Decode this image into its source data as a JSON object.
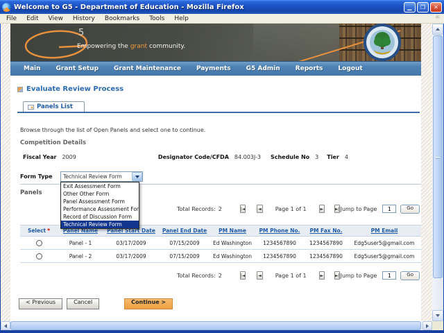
{
  "window": {
    "title": "Welcome to G5 - Department of Education - Mozilla Firefox",
    "controls": {
      "minimize": "▁",
      "restore": "❐",
      "close": "✕"
    },
    "menu_items": [
      "File",
      "Edit",
      "View",
      "History",
      "Bookmarks",
      "Tools",
      "Help"
    ],
    "throbber_glyph": "✳"
  },
  "header": {
    "logo_number": "5",
    "tagline_prefix": "Empowering the",
    "tagline_accent": "grant",
    "tagline_suffix": "community."
  },
  "nav": {
    "items": [
      "Main",
      "Grant Setup",
      "Grant Maintenance",
      "Payments",
      "G5 Admin",
      "Reports",
      "Logout"
    ]
  },
  "main": {
    "page_title": "Evaluate Review Process",
    "tab_label": "Panels List",
    "instruction": "Browse through the list of Open Panels and select one to continue.",
    "competition": {
      "heading": "Competition Details",
      "fiscal_year_label": "Fiscal Year",
      "fiscal_year_value": "2009",
      "designator_label": "Designator Code/CFDA",
      "designator_value": "84.003J-3",
      "schedule_label": "Schedule No",
      "schedule_value": "3",
      "tier_label": "Tier",
      "tier_value": "4"
    },
    "form_type": {
      "label": "Form Type",
      "selected": "Technical Review Form",
      "options": [
        "Exit Assessment Form",
        "Other Other Form",
        "Panel Assessment Form",
        "Performance Assessment Form",
        "Record of Discussion Form",
        "Technical Review Form"
      ],
      "highlighted_option": "Technical Review Form"
    },
    "panels_heading": "Panels",
    "pagination": {
      "total_label": "Total Records:",
      "total_value": "2",
      "first_glyph": "|◄",
      "prev_glyph": "◄",
      "page_status": "Page 1 of 1",
      "next_glyph": "►",
      "last_glyph": "►|",
      "jump_label": "Jump to Page",
      "jump_value": "1",
      "go_label": "Go"
    },
    "table": {
      "select_header": "Select",
      "required_marker": "*",
      "headers": [
        "Panel Name",
        "Panel Start Date",
        "Panel End Date",
        "PM Name",
        "PM Phone No.",
        "PM Fax No.",
        "PM Email"
      ],
      "rows": [
        {
          "panel_name": "Panel - 1",
          "start_date": "03/17/2009",
          "end_date": "07/15/2009",
          "pm_name": "Ed Washington",
          "pm_phone": "1234567890",
          "pm_fax": "1234567890",
          "pm_email": "Edg5user5@gmail.com"
        },
        {
          "panel_name": "Panel - 2",
          "start_date": "03/17/2009",
          "end_date": "07/15/2009",
          "pm_name": "Ed Washington",
          "pm_phone": "1234567890",
          "pm_fax": "1234567890",
          "pm_email": "Edg5user5@gmail.com"
        }
      ]
    },
    "actions": {
      "previous": "< Previous",
      "cancel": "Cancel",
      "continue": "Continue >"
    }
  },
  "colors": {
    "nav_blue": "#4e81b4",
    "link_blue": "#1f5ba8",
    "accent_orange": "#f09a3e",
    "dropdown_highlight": "#12368f",
    "titlebar_blue": "#1c51c4"
  }
}
